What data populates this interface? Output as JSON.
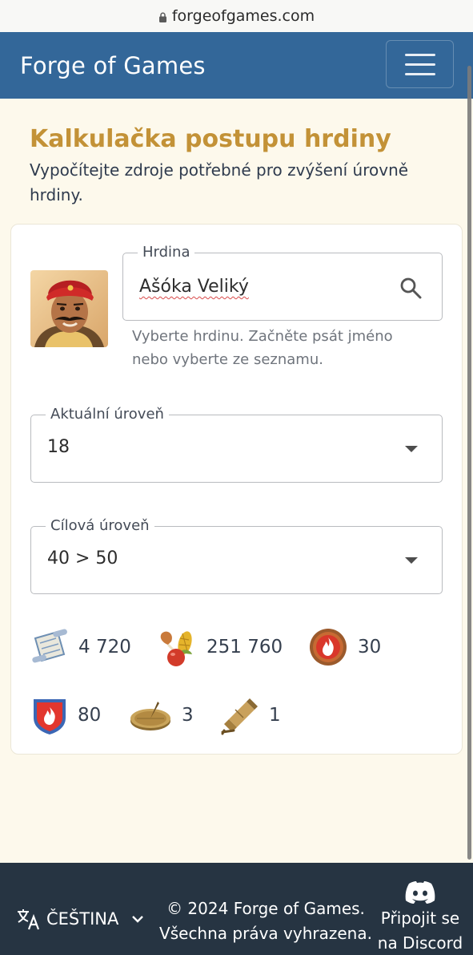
{
  "browser": {
    "url": "forgeofgames.com"
  },
  "navbar": {
    "brand": "Forge of Games"
  },
  "page": {
    "title": "Kalkulačka postupu hrdiny",
    "subtitle": "Vypočítejte zdroje potřebné pro zvýšení úrovně hrdiny."
  },
  "hero_field": {
    "label": "Hrdina",
    "value": "Ašóka Veliký",
    "hint": "Vyberte hrdinu. Začněte psát jméno nebo vyberte ze seznamu."
  },
  "current_level": {
    "label": "Aktuální úroveň",
    "value": "18"
  },
  "target_level": {
    "label": "Cílová úroveň",
    "value": "40 > 50"
  },
  "resources": [
    {
      "icon": "scroll-map-icon",
      "value": "4 720"
    },
    {
      "icon": "food-icon",
      "value": "251 760"
    },
    {
      "icon": "fire-medal-icon",
      "value": "30"
    },
    {
      "icon": "fire-shield-icon",
      "value": "80"
    },
    {
      "icon": "sundial-icon",
      "value": "3"
    },
    {
      "icon": "telescope-icon",
      "value": "1"
    }
  ],
  "footer": {
    "language": "ČEŠTINA",
    "copyright_line1": "© 2024 Forge of Games.",
    "copyright_line2": "Všechna práva vyhrazena.",
    "discord_line1": "Připojit se",
    "discord_line2": "na Discord"
  },
  "colors": {
    "navbar": "#336799",
    "title_gold": "#c39237",
    "page_bg": "#fdf9ec",
    "footer_bg": "#263442"
  }
}
